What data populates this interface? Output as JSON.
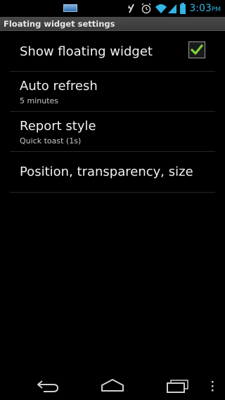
{
  "status_bar": {
    "time": "3:03",
    "ampm": "PM",
    "icons": [
      "notification-battery-icon",
      "mute-icon",
      "alarm-icon",
      "wifi-icon",
      "signal-icon",
      "battery-icon"
    ]
  },
  "title_bar": {
    "title": "Floating widget settings"
  },
  "preferences": [
    {
      "title": "Show floating widget",
      "summary": "",
      "checked": true
    },
    {
      "title": "Auto refresh",
      "summary": "5 minutes"
    },
    {
      "title": "Report style",
      "summary": "Quick toast (1s)"
    },
    {
      "title": "Position, transparency, size",
      "summary": ""
    }
  ],
  "nav_bar": {
    "buttons": [
      "back-icon",
      "home-icon",
      "recent-apps-icon",
      "overflow-menu-icon"
    ]
  },
  "colors": {
    "accent": "#33b5e5",
    "check": "#7fd13b",
    "background": "#000000"
  }
}
